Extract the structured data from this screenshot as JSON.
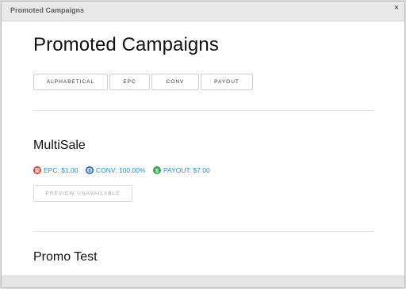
{
  "window": {
    "title": "Promoted Campaigns",
    "close_glyph": "×"
  },
  "page": {
    "heading": "Promoted Campaigns"
  },
  "sort_buttons": [
    "ALPHABETICAL",
    "EPC",
    "CONV",
    "PAYOUT"
  ],
  "campaigns": [
    {
      "name": "MultiSale",
      "stats": [
        {
          "icon": "calculator-icon",
          "text": "EPC: $1.00"
        },
        {
          "icon": "globe-icon",
          "text": "CONV: 100.00%"
        },
        {
          "icon": "dollar-icon",
          "text": "PAYOUT: $7.00"
        }
      ],
      "preview_label": "PREVIEW UNAVAILABLE"
    },
    {
      "name": "Promo Test"
    }
  ],
  "colors": {
    "stat_text": "#1e8fd6",
    "epc_icon": "#e53e2f",
    "conv_icon": "#1f63b8",
    "payout_icon": "#34a853"
  }
}
